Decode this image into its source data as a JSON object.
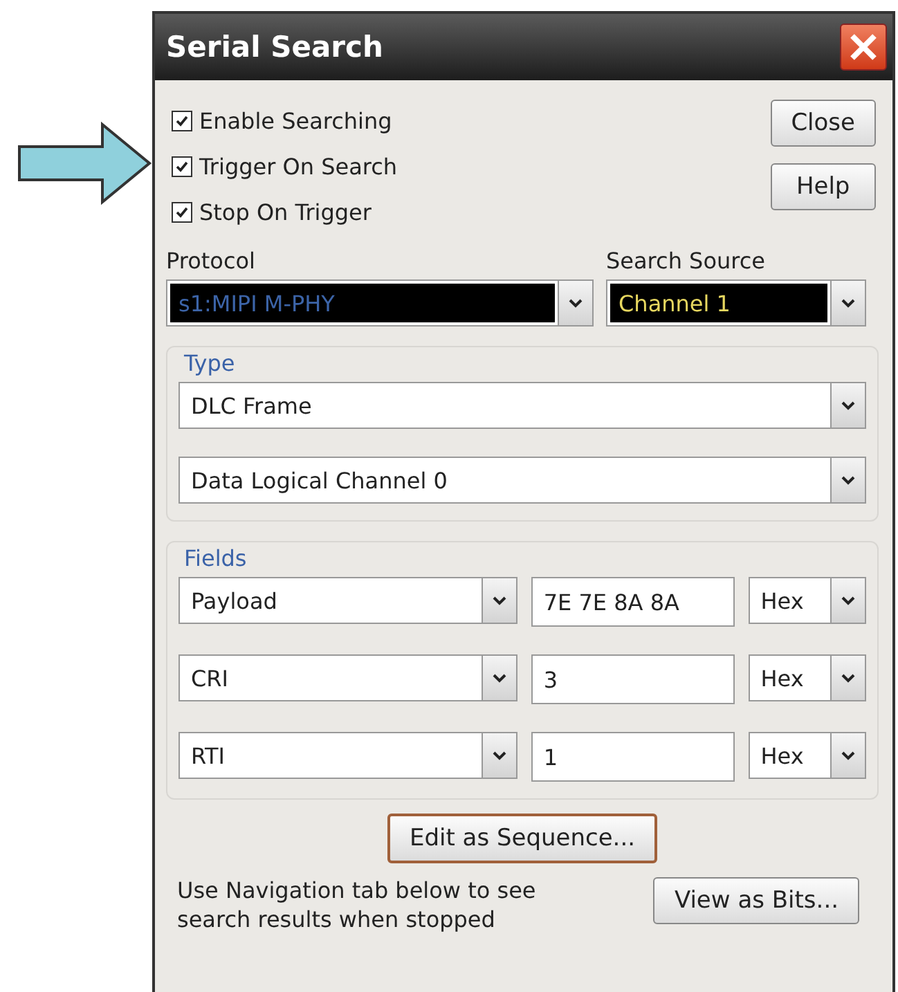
{
  "window": {
    "title": "Serial Search"
  },
  "options": [
    {
      "label": "Enable Searching",
      "checked": true
    },
    {
      "label": "Trigger On Search",
      "checked": true
    },
    {
      "label": "Stop On Trigger",
      "checked": true
    }
  ],
  "buttons": [
    {
      "label": "Close"
    },
    {
      "label": "Help"
    }
  ],
  "protocol": {
    "label": "Protocol",
    "value": "s1:MIPI M-PHY"
  },
  "search_source": {
    "label": "Search Source",
    "value": "Channel 1"
  },
  "type": {
    "label": "Type",
    "selects": [
      {
        "value": "DLC Frame"
      },
      {
        "value": "Data Logical Channel 0"
      }
    ]
  },
  "fields": {
    "label": "Fields",
    "rows": [
      {
        "name": "Payload",
        "value": "7E 7E 8A 8A",
        "format": "Hex"
      },
      {
        "name": "CRI",
        "value": "3",
        "format": "Hex"
      },
      {
        "name": "RTI",
        "value": "1",
        "format": "Hex"
      }
    ]
  },
  "edit_button": {
    "label": "Edit as Sequence...",
    "focused": true
  },
  "hint": "Use Navigation tab below to see search results when stopped",
  "bits_button": {
    "label": "View as Bits..."
  }
}
